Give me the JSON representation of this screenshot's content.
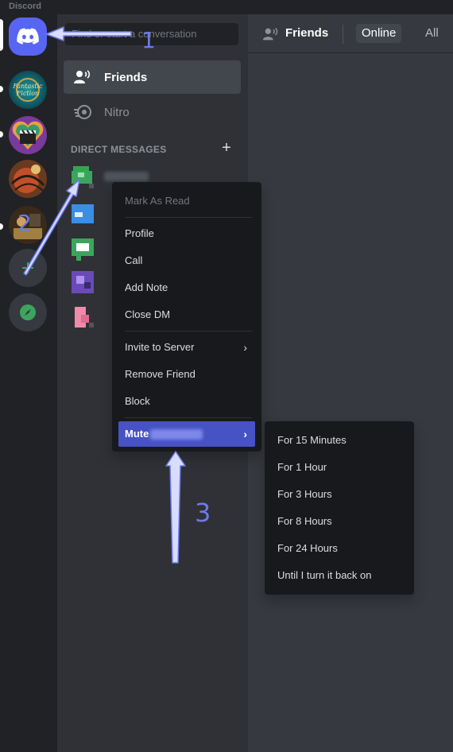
{
  "app": {
    "title": "Discord"
  },
  "search": {
    "placeholder": "Find or start a conversation"
  },
  "nav": {
    "friends_label": "Friends",
    "nitro_label": "Nitro"
  },
  "dm": {
    "header": "DIRECT MESSAGES"
  },
  "topbar": {
    "friends_label": "Friends",
    "tab_online": "Online",
    "tab_all": "All"
  },
  "context_menu": {
    "mark_as_read": "Mark As Read",
    "profile": "Profile",
    "call": "Call",
    "add_note": "Add Note",
    "close_dm": "Close DM",
    "invite_to_server": "Invite to Server",
    "remove_friend": "Remove Friend",
    "block": "Block",
    "mute": "Mute"
  },
  "mute_submenu": {
    "items": [
      "For 15 Minutes",
      "For 1 Hour",
      "For 3 Hours",
      "For 8 Hours",
      "For 24 Hours",
      "Until I turn it back on"
    ]
  },
  "annotations": {
    "step1": "1",
    "step2": "2",
    "step3": "3"
  },
  "colors": {
    "accent": "#5865f2",
    "highlight": "#4752c4",
    "annotation": "#6d7ae8",
    "explore_green": "#3ba55d"
  }
}
